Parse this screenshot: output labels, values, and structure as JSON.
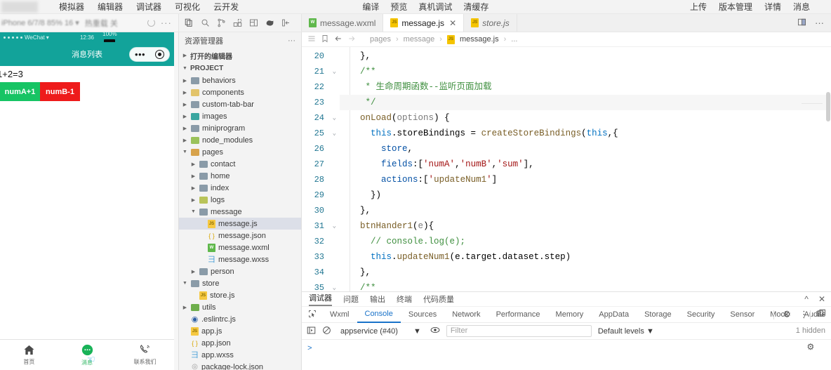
{
  "menu": {
    "main_items": [
      "模拟器",
      "编辑器",
      "调试器",
      "可视化",
      "云开发"
    ],
    "mid_items": [
      "编译",
      "预览",
      "真机调试",
      "清缓存"
    ],
    "right_items": [
      "上传",
      "版本管理",
      "详情",
      "消息"
    ]
  },
  "sim_toolbar": {
    "device": "iPhone 6/7/8",
    "scale": "85%",
    "font_size": "16",
    "hot_reload": "热重载 关",
    "refresh_icon": "refresh-icon",
    "more_icon": "more-icon"
  },
  "explorer_icons": [
    "files-icon",
    "search-icon",
    "source-control-icon",
    "extensions-icon",
    "layout-icon",
    "plugin-icon",
    "collapse-icon"
  ],
  "tabs": [
    {
      "label": "message.wxml",
      "icon": "wxml",
      "active": false,
      "italic": false,
      "closable": false
    },
    {
      "label": "message.js",
      "icon": "js",
      "active": true,
      "italic": false,
      "closable": true
    },
    {
      "label": "store.js",
      "icon": "js",
      "active": false,
      "italic": true,
      "closable": false
    }
  ],
  "tabstrip_right": [
    "split-editor-icon",
    "more-actions-icon"
  ],
  "simulator": {
    "status_carrier": "WeChat",
    "status_time": "12:36",
    "status_battery": "100%",
    "nav_title": "消息列表",
    "capsule_more": "•••",
    "capsule_target": "target-icon",
    "sum_text": "1+2=3",
    "buttons": [
      {
        "label": "numA+1",
        "color": "#17c464"
      },
      {
        "label": "numB-1",
        "color": "#ee1b1b"
      }
    ],
    "tabbar": [
      {
        "label": "首页",
        "icon": "home-icon",
        "active": false
      },
      {
        "label": "消息",
        "icon": "message-icon",
        "active": true
      },
      {
        "label": "联系我们",
        "icon": "phone-icon",
        "active": false
      }
    ]
  },
  "explorer": {
    "title": "资源管理器",
    "more_icon": "more-icon",
    "open_editors": "打开的编辑器",
    "project": "PROJECT",
    "tree": [
      {
        "label": "behaviors",
        "depth": 1,
        "kind": "folder",
        "folder_color": "gray",
        "twist": "right",
        "selected": false
      },
      {
        "label": "components",
        "depth": 1,
        "kind": "folder",
        "folder_color": "yellow",
        "twist": "right",
        "selected": false
      },
      {
        "label": "custom-tab-bar",
        "depth": 1,
        "kind": "folder",
        "folder_color": "gray",
        "twist": "right",
        "selected": false
      },
      {
        "label": "images",
        "depth": 1,
        "kind": "folder",
        "folder_color": "teal",
        "twist": "right",
        "selected": false
      },
      {
        "label": "miniprogram",
        "depth": 1,
        "kind": "folder",
        "folder_color": "gray",
        "twist": "right",
        "selected": false
      },
      {
        "label": "node_modules",
        "depth": 1,
        "kind": "folder",
        "folder_color": "green",
        "twist": "right",
        "selected": false
      },
      {
        "label": "pages",
        "depth": 1,
        "kind": "folder",
        "folder_color": "ocher",
        "twist": "down",
        "selected": false
      },
      {
        "label": "contact",
        "depth": 2,
        "kind": "folder",
        "folder_color": "gray",
        "twist": "right",
        "selected": false
      },
      {
        "label": "home",
        "depth": 2,
        "kind": "folder",
        "folder_color": "gray",
        "twist": "right",
        "selected": false
      },
      {
        "label": "index",
        "depth": 2,
        "kind": "folder",
        "folder_color": "gray",
        "twist": "right",
        "selected": false
      },
      {
        "label": "logs",
        "depth": 2,
        "kind": "folder",
        "folder_color": "olive",
        "twist": "right",
        "selected": false
      },
      {
        "label": "message",
        "depth": 2,
        "kind": "folder",
        "folder_color": "gray",
        "twist": "down",
        "selected": false
      },
      {
        "label": "message.js",
        "depth": 3,
        "kind": "file",
        "file_type": "js",
        "twist": "none",
        "selected": true
      },
      {
        "label": "message.json",
        "depth": 3,
        "kind": "file",
        "file_type": "json",
        "twist": "none",
        "selected": false
      },
      {
        "label": "message.wxml",
        "depth": 3,
        "kind": "file",
        "file_type": "wxml",
        "twist": "none",
        "selected": false
      },
      {
        "label": "message.wxss",
        "depth": 3,
        "kind": "file",
        "file_type": "wxss",
        "twist": "none",
        "selected": false
      },
      {
        "label": "person",
        "depth": 2,
        "kind": "folder",
        "folder_color": "gray",
        "twist": "right",
        "selected": false
      },
      {
        "label": "store",
        "depth": 1,
        "kind": "folder",
        "folder_color": "gray",
        "twist": "down",
        "selected": false
      },
      {
        "label": "store.js",
        "depth": 2,
        "kind": "file",
        "file_type": "js",
        "twist": "none",
        "selected": false
      },
      {
        "label": "utils",
        "depth": 1,
        "kind": "folder",
        "folder_color": "greendark",
        "twist": "right",
        "selected": false
      },
      {
        "label": ".eslintrc.js",
        "depth": 1,
        "kind": "file",
        "file_type": "eslint",
        "twist": "none",
        "selected": false
      },
      {
        "label": "app.js",
        "depth": 1,
        "kind": "file",
        "file_type": "js",
        "twist": "none",
        "selected": false
      },
      {
        "label": "app.json",
        "depth": 1,
        "kind": "file",
        "file_type": "json",
        "twist": "none",
        "selected": false
      },
      {
        "label": "app.wxss",
        "depth": 1,
        "kind": "file",
        "file_type": "wxss",
        "twist": "none",
        "selected": false
      },
      {
        "label": "package-lock.json",
        "depth": 1,
        "kind": "file",
        "file_type": "lock",
        "twist": "none",
        "selected": false
      }
    ]
  },
  "breadcrumb": {
    "menu_icon": "menu-icon",
    "bookmark_icon": "bookmark-icon",
    "back_icon": "arrow-left-icon",
    "forward_icon": "arrow-right-icon",
    "path": [
      "pages",
      "message",
      "message.js",
      "..."
    ]
  },
  "editor": {
    "lines": [
      {
        "n": "20",
        "fold": "",
        "text": "  },"
      },
      {
        "n": "21",
        "fold": "v",
        "text": "  /**"
      },
      {
        "n": "22",
        "fold": "",
        "text": "   * 生命周期函数--监听页面加载"
      },
      {
        "n": "23",
        "fold": "",
        "text": "   */"
      },
      {
        "n": "24",
        "fold": "v",
        "text": "  onLoad(options) {"
      },
      {
        "n": "25",
        "fold": "v",
        "text": "    this.storeBindings = createStoreBindings(this,{"
      },
      {
        "n": "26",
        "fold": "",
        "text": "      store,"
      },
      {
        "n": "27",
        "fold": "",
        "text": "      fields:['numA','numB','sum'],"
      },
      {
        "n": "28",
        "fold": "",
        "text": "      actions:['updateNum1']"
      },
      {
        "n": "29",
        "fold": "",
        "text": "    })"
      },
      {
        "n": "30",
        "fold": "",
        "text": "  },"
      },
      {
        "n": "31",
        "fold": "v",
        "text": "  btnHander1(e){"
      },
      {
        "n": "32",
        "fold": "",
        "text": "    // console.log(e);"
      },
      {
        "n": "33",
        "fold": "",
        "text": "    this.updateNum1(e.target.dataset.step)"
      },
      {
        "n": "34",
        "fold": "",
        "text": "  },"
      },
      {
        "n": "35",
        "fold": "v",
        "text": "  /**"
      }
    ]
  },
  "devtools": {
    "panel_tabs": [
      "调试器",
      "问题",
      "输出",
      "终端",
      "代码质量"
    ],
    "panel_active": "调试器",
    "panel_icons": [
      "collapse-icon",
      "close-icon"
    ],
    "inspect_icon": "inspect-element-icon",
    "dev_tabs": [
      "Wxml",
      "Console",
      "Sources",
      "Network",
      "Performance",
      "Memory",
      "AppData",
      "Storage",
      "Security",
      "Sensor",
      "Mock",
      "Audits"
    ],
    "dev_tabs_overflow": "»",
    "dev_active": "Console",
    "dev_right_icons": [
      "settings-gear-icon",
      "more-vertical-icon",
      "dock-panel-icon"
    ],
    "console": {
      "execute_icon": "execute-icon",
      "clear_icon": "clear-console-icon",
      "context": "appservice (#40)",
      "context_caret": "▼",
      "eye_icon": "live-expression-icon",
      "filter_placeholder": "Filter",
      "levels": "Default levels",
      "levels_caret": "▼",
      "hidden_count": "1 hidden",
      "settings_icon": "console-settings-icon",
      "prompt": ">"
    }
  },
  "colors": {
    "wechat_teal": "#12a39a",
    "accent_blue": "#1a73c9",
    "green_button": "#17c464",
    "red_button": "#ee1b1b",
    "line_number": "#237893"
  }
}
